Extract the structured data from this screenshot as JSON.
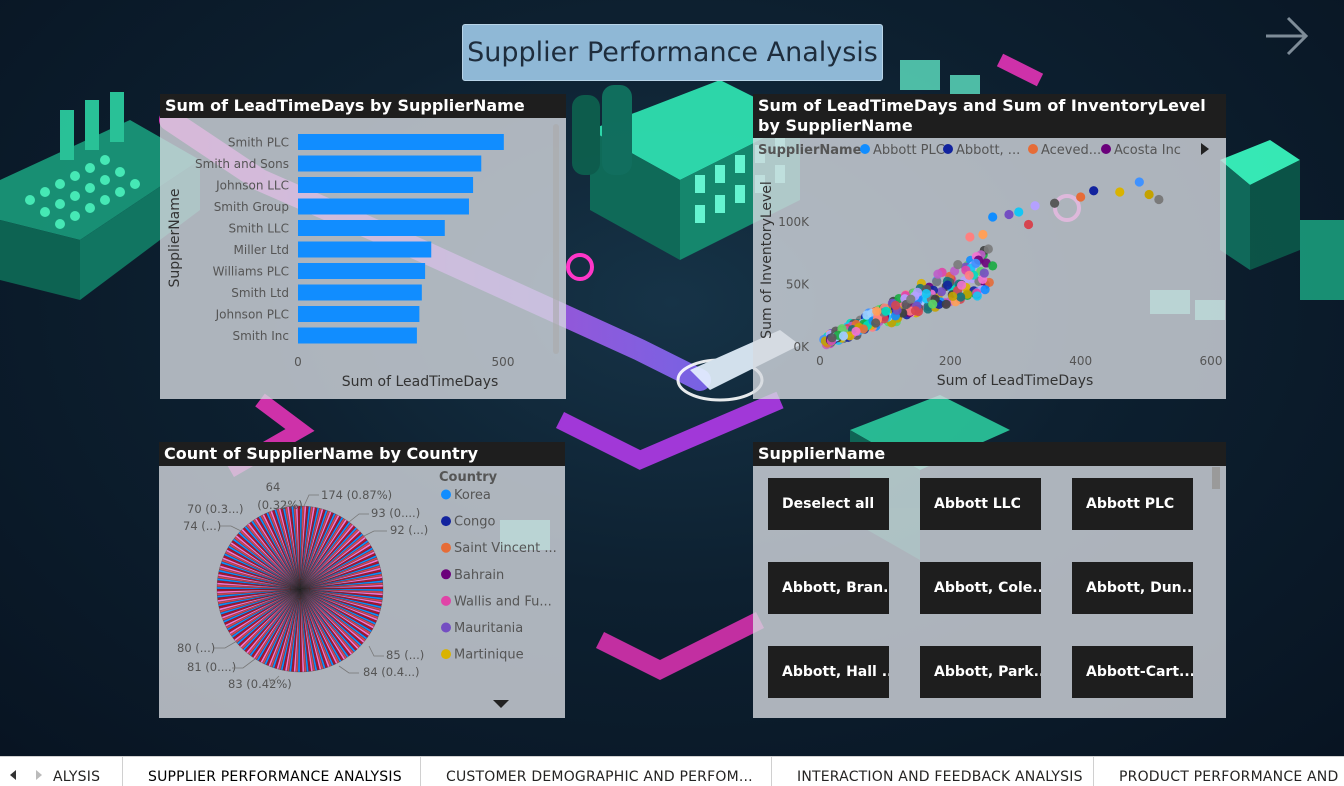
{
  "page_title": "Supplier Performance Analysis",
  "bar_chart": {
    "title": "Sum of LeadTimeDays by SupplierName",
    "chart_data": {
      "type": "bar",
      "orientation": "horizontal",
      "categories": [
        "Smith PLC",
        "Smith and Sons",
        "Johnson LLC",
        "Smith Group",
        "Smith LLC",
        "Miller Ltd",
        "Williams PLC",
        "Smith Ltd",
        "Johnson PLC",
        "Smith Inc"
      ],
      "values": [
        502,
        447,
        427,
        417,
        358,
        325,
        310,
        302,
        296,
        290
      ],
      "xlabel": "Sum of LeadTimeDays",
      "ylabel": "SupplierName",
      "xlim": [
        0,
        500
      ],
      "xticks": [
        "0",
        "500"
      ],
      "color": "#118DFF"
    }
  },
  "scatter_chart": {
    "title": "Sum of LeadTimeDays and Sum of InventoryLevel by SupplierName",
    "legend_title": "SupplierName",
    "legend": [
      {
        "label": "Abbott PLC",
        "color": "#118DFF"
      },
      {
        "label": "Abbott, ...",
        "color": "#12239E"
      },
      {
        "label": "Aceved...",
        "color": "#E66C37"
      },
      {
        "label": "Acosta Inc",
        "color": "#6B007B"
      }
    ],
    "chart_data": {
      "type": "scatter",
      "xlabel": "Sum of LeadTimeDays",
      "ylabel": "Sum of InventoryLevel",
      "xlim": [
        0,
        600
      ],
      "ylim": [
        0,
        140000
      ],
      "xticks": [
        "0",
        "200",
        "400",
        "600"
      ],
      "yticks": [
        "0K",
        "50K",
        "100K"
      ],
      "points_note": "dense cluster of several hundred suppliers, concentrated between 0–200 LeadTimeDays and 0–60K InventoryLevel, thinning out toward 520 / 130K"
    }
  },
  "pie_chart": {
    "title": "Count of SupplierName by Country",
    "legend_title": "Country",
    "legend": [
      {
        "label": "Korea",
        "color": "#118DFF"
      },
      {
        "label": "Congo",
        "color": "#12239E"
      },
      {
        "label": "Saint Vincent ...",
        "color": "#E66C37"
      },
      {
        "label": "Bahrain",
        "color": "#6B007B"
      },
      {
        "label": "Wallis and Fu...",
        "color": "#E044A7"
      },
      {
        "label": "Mauritania",
        "color": "#744EC2"
      },
      {
        "label": "Martinique",
        "color": "#D9B300"
      }
    ],
    "chart_data": {
      "type": "pie",
      "note": "about 240 country slices, each under 1%",
      "labels": [
        {
          "text": "174 (0.87%)"
        },
        {
          "text": "93 (0....)"
        },
        {
          "text": "92 (...)"
        },
        {
          "text": "64"
        },
        {
          "text": "(0.32%)"
        },
        {
          "text": "70 (0.3...)"
        },
        {
          "text": "74 (...)"
        },
        {
          "text": "85 (...)"
        },
        {
          "text": "84 (0.4...)"
        },
        {
          "text": "80 (...)"
        },
        {
          "text": "81 (0....)"
        },
        {
          "text": "83 (0.42%)"
        }
      ]
    }
  },
  "slicer": {
    "title": "SupplierName",
    "buttons": [
      "Deselect all",
      "Abbott LLC",
      "Abbott PLC",
      "Abbott, Bran...",
      "Abbott, Cole...",
      "Abbott, Dun...",
      "Abbott, Hall ...",
      "Abbott, Park...",
      "Abbott-Cart..."
    ]
  },
  "tabs": [
    "ALYSIS",
    "SUPPLIER PERFORMANCE ANALYSIS",
    "CUSTOMER DEMOGRAPHIC AND PERFOM...",
    "INTERACTION AND FEEDBACK ANALYSIS",
    "PRODUCT PERFORMANCE AND SA"
  ],
  "active_tab": "SUPPLIER PERFORMANCE ANALYSIS",
  "icons": {
    "nav_next": "arrow-right-icon",
    "tab_prev": "triangle-left-icon",
    "tab_next": "triangle-right-icon"
  }
}
